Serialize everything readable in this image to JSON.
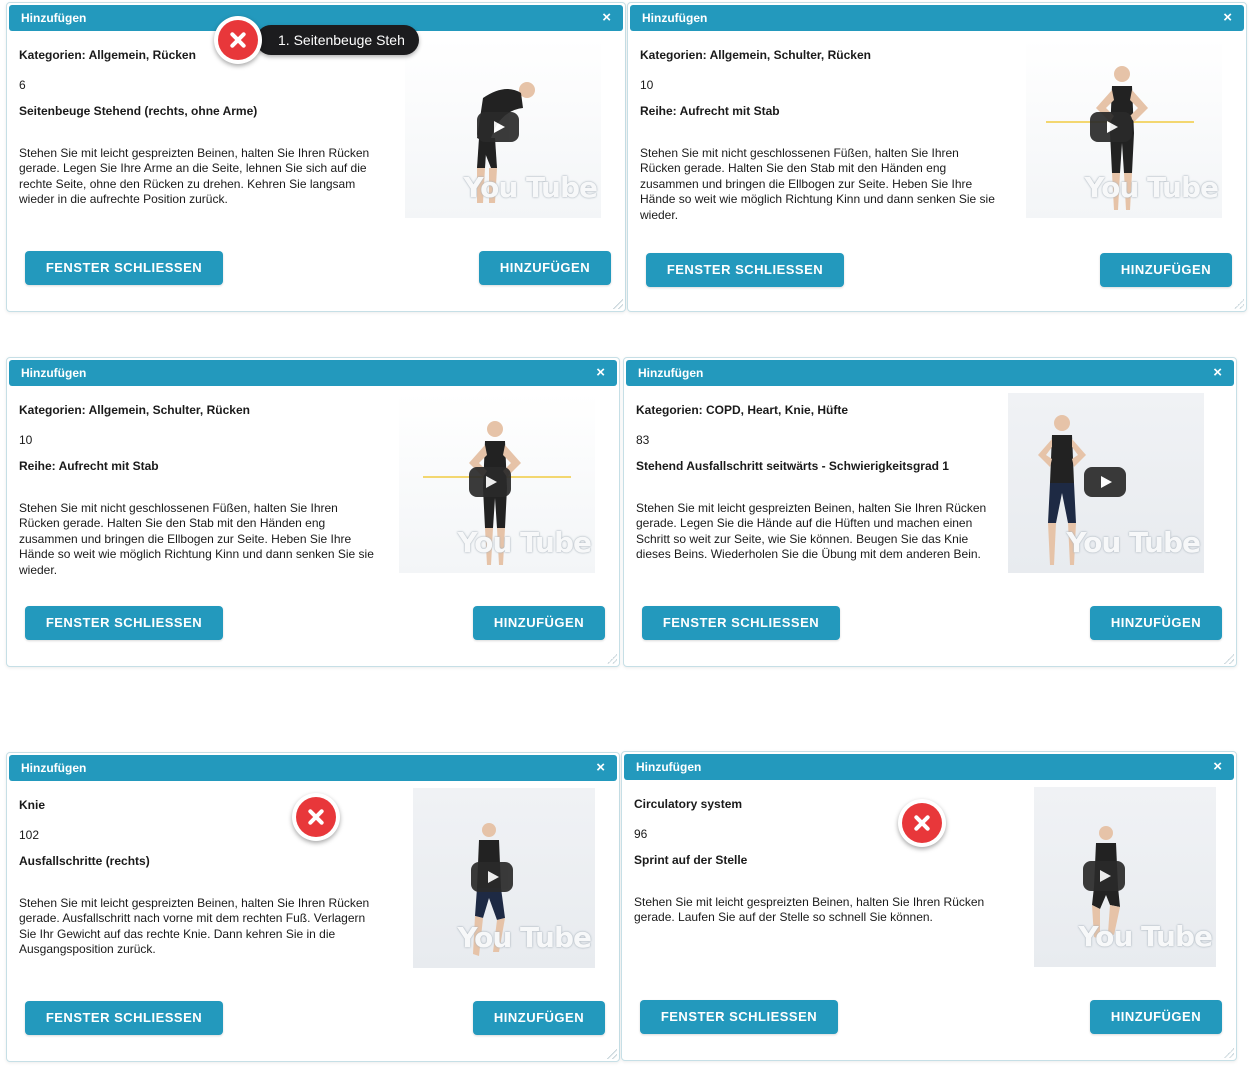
{
  "dialogs": [
    {
      "title": "Hinzufügen",
      "close_icon": "×",
      "categories": "Kategorien: Allgemein, Rücken",
      "number": "6",
      "exercise": "Seitenbeuge Stehend (rechts, ohne Arme)",
      "description": "Stehen Sie mit leicht gespreizten Beinen, halten Sie Ihren Rücken gerade. Legen Sie Ihre Arme an die Seite, lehnen Sie sich auf die rechte Seite, ohne den Rücken zu drehen. Kehren Sie langsam wieder in die aufrechte Position zurück.",
      "close_button": "FENSTER SCHLIESSEN",
      "add_button": "HINZUFÜGEN",
      "video_watermark": "You Tube"
    },
    {
      "title": "Hinzufügen",
      "close_icon": "×",
      "categories": "Kategorien: Allgemein, Schulter, Rücken",
      "number": "10",
      "exercise": "Reihe: Aufrecht mit Stab",
      "description": "Stehen Sie mit nicht geschlossenen Füßen, halten Sie Ihren Rücken gerade. Halten Sie den Stab mit den Händen eng zusammen und bringen die Ellbogen zur Seite. Heben Sie Ihre Hände so weit wie möglich Richtung Kinn und dann senken Sie sie wieder.",
      "close_button": "FENSTER SCHLIESSEN",
      "add_button": "HINZUFÜGEN",
      "video_watermark": "You Tube"
    },
    {
      "title": "Hinzufügen",
      "close_icon": "×",
      "categories": "Kategorien: Allgemein, Schulter, Rücken",
      "number": "10",
      "exercise": "Reihe: Aufrecht mit Stab",
      "description": "Stehen Sie mit nicht geschlossenen Füßen, halten Sie Ihren Rücken gerade. Halten Sie den Stab mit den Händen eng zusammen und bringen die Ellbogen zur Seite. Heben Sie Ihre Hände so weit wie möglich Richtung Kinn und dann senken Sie sie wieder.",
      "close_button": "FENSTER SCHLIESSEN",
      "add_button": "HINZUFÜGEN",
      "video_watermark": "You Tube"
    },
    {
      "title": "Hinzufügen",
      "close_icon": "×",
      "categories": "Kategorien: COPD, Heart, Knie, Hüfte",
      "number": "83",
      "exercise": "Stehend Ausfallschritt seitwärts - Schwierigkeitsgrad 1",
      "description": "Stehen Sie mit leicht gespreizten Beinen, halten Sie Ihren Rücken gerade. Legen Sie die Hände auf die Hüften und machen einen Schritt so weit zur Seite, wie Sie können. Beugen Sie das Knie dieses Beins. Wiederholen Sie die Übung mit dem anderen Bein.",
      "close_button": "FENSTER SCHLIESSEN",
      "add_button": "HINZUFÜGEN",
      "video_watermark": "You Tube"
    },
    {
      "title": "Hinzufügen",
      "close_icon": "×",
      "categories": "Knie",
      "number": "102",
      "exercise": "Ausfallschritte (rechts)",
      "description": "Stehen Sie mit leicht gespreizten Beinen, halten Sie Ihren Rücken gerade. Ausfallschritt nach vorne mit dem rechten Fuß. Verlagern Sie Ihr Gewicht auf das rechte Knie. Dann kehren Sie in die Ausgangsposition zurück.",
      "close_button": "FENSTER SCHLIESSEN",
      "add_button": "HINZUFÜGEN",
      "video_watermark": "You Tube"
    },
    {
      "title": "Hinzufügen",
      "close_icon": "×",
      "categories": "Circulatory system",
      "number": "96",
      "exercise": "Sprint auf der Stelle",
      "description": "Stehen Sie mit leicht gespreizten Beinen, halten Sie Ihren Rücken gerade. Laufen Sie auf der Stelle so schnell Sie können.",
      "close_button": "FENSTER SCHLIESSEN",
      "add_button": "HINZUFÜGEN",
      "video_watermark": "You Tube"
    }
  ],
  "tooltip": {
    "text": "1. Seitenbeuge Steh"
  },
  "colors": {
    "accent": "#2399bd",
    "marker_red": "#e8373a"
  }
}
